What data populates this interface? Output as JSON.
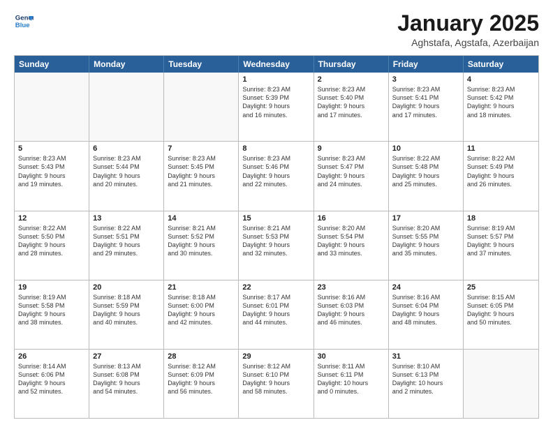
{
  "header": {
    "logo_line1": "General",
    "logo_line2": "Blue",
    "month": "January 2025",
    "location": "Aghstafa, Agstafa, Azerbaijan"
  },
  "weekdays": [
    "Sunday",
    "Monday",
    "Tuesday",
    "Wednesday",
    "Thursday",
    "Friday",
    "Saturday"
  ],
  "rows": [
    [
      {
        "day": "",
        "text": ""
      },
      {
        "day": "",
        "text": ""
      },
      {
        "day": "",
        "text": ""
      },
      {
        "day": "1",
        "text": "Sunrise: 8:23 AM\nSunset: 5:39 PM\nDaylight: 9 hours\nand 16 minutes."
      },
      {
        "day": "2",
        "text": "Sunrise: 8:23 AM\nSunset: 5:40 PM\nDaylight: 9 hours\nand 17 minutes."
      },
      {
        "day": "3",
        "text": "Sunrise: 8:23 AM\nSunset: 5:41 PM\nDaylight: 9 hours\nand 17 minutes."
      },
      {
        "day": "4",
        "text": "Sunrise: 8:23 AM\nSunset: 5:42 PM\nDaylight: 9 hours\nand 18 minutes."
      }
    ],
    [
      {
        "day": "5",
        "text": "Sunrise: 8:23 AM\nSunset: 5:43 PM\nDaylight: 9 hours\nand 19 minutes."
      },
      {
        "day": "6",
        "text": "Sunrise: 8:23 AM\nSunset: 5:44 PM\nDaylight: 9 hours\nand 20 minutes."
      },
      {
        "day": "7",
        "text": "Sunrise: 8:23 AM\nSunset: 5:45 PM\nDaylight: 9 hours\nand 21 minutes."
      },
      {
        "day": "8",
        "text": "Sunrise: 8:23 AM\nSunset: 5:46 PM\nDaylight: 9 hours\nand 22 minutes."
      },
      {
        "day": "9",
        "text": "Sunrise: 8:23 AM\nSunset: 5:47 PM\nDaylight: 9 hours\nand 24 minutes."
      },
      {
        "day": "10",
        "text": "Sunrise: 8:22 AM\nSunset: 5:48 PM\nDaylight: 9 hours\nand 25 minutes."
      },
      {
        "day": "11",
        "text": "Sunrise: 8:22 AM\nSunset: 5:49 PM\nDaylight: 9 hours\nand 26 minutes."
      }
    ],
    [
      {
        "day": "12",
        "text": "Sunrise: 8:22 AM\nSunset: 5:50 PM\nDaylight: 9 hours\nand 28 minutes."
      },
      {
        "day": "13",
        "text": "Sunrise: 8:22 AM\nSunset: 5:51 PM\nDaylight: 9 hours\nand 29 minutes."
      },
      {
        "day": "14",
        "text": "Sunrise: 8:21 AM\nSunset: 5:52 PM\nDaylight: 9 hours\nand 30 minutes."
      },
      {
        "day": "15",
        "text": "Sunrise: 8:21 AM\nSunset: 5:53 PM\nDaylight: 9 hours\nand 32 minutes."
      },
      {
        "day": "16",
        "text": "Sunrise: 8:20 AM\nSunset: 5:54 PM\nDaylight: 9 hours\nand 33 minutes."
      },
      {
        "day": "17",
        "text": "Sunrise: 8:20 AM\nSunset: 5:55 PM\nDaylight: 9 hours\nand 35 minutes."
      },
      {
        "day": "18",
        "text": "Sunrise: 8:19 AM\nSunset: 5:57 PM\nDaylight: 9 hours\nand 37 minutes."
      }
    ],
    [
      {
        "day": "19",
        "text": "Sunrise: 8:19 AM\nSunset: 5:58 PM\nDaylight: 9 hours\nand 38 minutes."
      },
      {
        "day": "20",
        "text": "Sunrise: 8:18 AM\nSunset: 5:59 PM\nDaylight: 9 hours\nand 40 minutes."
      },
      {
        "day": "21",
        "text": "Sunrise: 8:18 AM\nSunset: 6:00 PM\nDaylight: 9 hours\nand 42 minutes."
      },
      {
        "day": "22",
        "text": "Sunrise: 8:17 AM\nSunset: 6:01 PM\nDaylight: 9 hours\nand 44 minutes."
      },
      {
        "day": "23",
        "text": "Sunrise: 8:16 AM\nSunset: 6:03 PM\nDaylight: 9 hours\nand 46 minutes."
      },
      {
        "day": "24",
        "text": "Sunrise: 8:16 AM\nSunset: 6:04 PM\nDaylight: 9 hours\nand 48 minutes."
      },
      {
        "day": "25",
        "text": "Sunrise: 8:15 AM\nSunset: 6:05 PM\nDaylight: 9 hours\nand 50 minutes."
      }
    ],
    [
      {
        "day": "26",
        "text": "Sunrise: 8:14 AM\nSunset: 6:06 PM\nDaylight: 9 hours\nand 52 minutes."
      },
      {
        "day": "27",
        "text": "Sunrise: 8:13 AM\nSunset: 6:08 PM\nDaylight: 9 hours\nand 54 minutes."
      },
      {
        "day": "28",
        "text": "Sunrise: 8:12 AM\nSunset: 6:09 PM\nDaylight: 9 hours\nand 56 minutes."
      },
      {
        "day": "29",
        "text": "Sunrise: 8:12 AM\nSunset: 6:10 PM\nDaylight: 9 hours\nand 58 minutes."
      },
      {
        "day": "30",
        "text": "Sunrise: 8:11 AM\nSunset: 6:11 PM\nDaylight: 10 hours\nand 0 minutes."
      },
      {
        "day": "31",
        "text": "Sunrise: 8:10 AM\nSunset: 6:13 PM\nDaylight: 10 hours\nand 2 minutes."
      },
      {
        "day": "",
        "text": ""
      }
    ]
  ]
}
